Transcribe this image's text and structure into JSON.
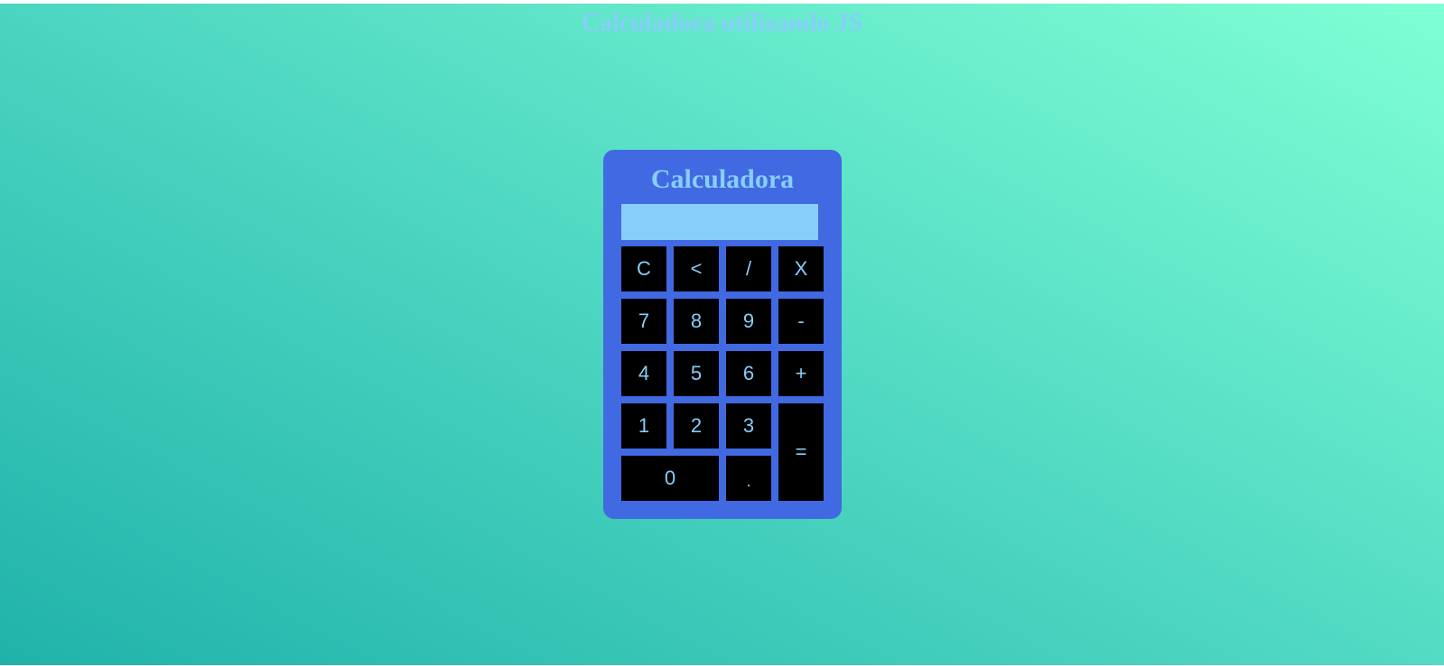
{
  "page": {
    "title": "Calculadora utilizando JS"
  },
  "calculator": {
    "title": "Calculadora",
    "display_value": "",
    "buttons": {
      "clear": "C",
      "backspace": "<",
      "divide": "/",
      "multiply": "X",
      "seven": "7",
      "eight": "8",
      "nine": "9",
      "minus": "-",
      "four": "4",
      "five": "5",
      "six": "6",
      "plus": "+",
      "one": "1",
      "two": "2",
      "three": "3",
      "equals": "=",
      "zero": "0",
      "decimal": "."
    }
  },
  "colors": {
    "accent_text": "#87cefa",
    "calculator_body": "#4169e1",
    "button_background": "#000000",
    "background_gradient_start": "#20b2aa",
    "background_gradient_end": "#7fffd4"
  }
}
